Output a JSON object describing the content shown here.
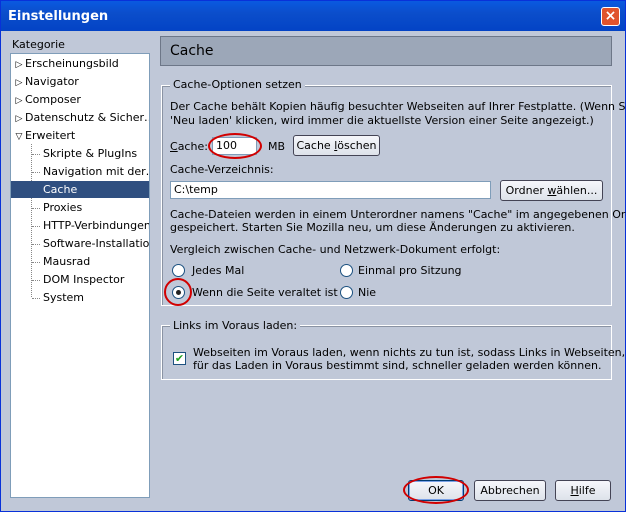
{
  "window": {
    "title": "Einstellungen",
    "close_glyph": "×"
  },
  "sidebar": {
    "heading": "Kategorie",
    "items": [
      {
        "label": "Erscheinungsbild",
        "expander": "▷"
      },
      {
        "label": "Navigator",
        "expander": "▷"
      },
      {
        "label": "Composer",
        "expander": "▷"
      },
      {
        "label": "Datenschutz & Sicher…",
        "expander": "▷"
      },
      {
        "label": "Erweitert",
        "expander": "▽"
      }
    ],
    "subitems": [
      {
        "label": "Skripte & PlugIns"
      },
      {
        "label": "Navigation mit der…"
      },
      {
        "label": "Cache",
        "selected": true
      },
      {
        "label": "Proxies"
      },
      {
        "label": "HTTP-Verbindungen"
      },
      {
        "label": "Software-Installation"
      },
      {
        "label": "Mausrad"
      },
      {
        "label": "DOM Inspector"
      },
      {
        "label": "System"
      }
    ]
  },
  "page": {
    "title": "Cache"
  },
  "cache_options": {
    "legend": "Cache-Optionen setzen",
    "description_line1": "Der Cache behält Kopien häufig besuchter Webseiten auf Ihrer Festplatte. (Wenn Sie",
    "description_line2": "'Neu laden' klicken, wird immer die aktuellste Version einer Seite angezeigt.)",
    "cache_label_accel": "C",
    "cache_label_rest": "ache:",
    "cache_size": "100",
    "unit": "MB",
    "clear_button_prefix": "Cache ",
    "clear_button_accel": "l",
    "clear_button_rest": "öschen",
    "directory_label": "Cache-Verzeichnis:",
    "directory_value": "C:\\temp",
    "choose_folder_prefix": "Ordner ",
    "choose_folder_accel": "w",
    "choose_folder_rest": "ählen...",
    "subfolder_line1": "Cache-Dateien werden in einem Unterordner namens \"Cache\" im angegebenen Ordner",
    "subfolder_line2": "gespeichert. Starten Sie Mozilla neu, um diese Änderungen zu aktivieren.",
    "compare_label": "Vergleich zwischen Cache- und Netzwerk-Dokument erfolgt:",
    "radios": [
      {
        "label": "Jedes Mal",
        "checked": false
      },
      {
        "label": "Einmal pro Sitzung",
        "checked": false
      },
      {
        "label": "Wenn die Seite veraltet ist",
        "checked": true
      },
      {
        "label": "Nie",
        "checked": false
      }
    ]
  },
  "prefetch": {
    "legend": "Links im Voraus laden:",
    "checkbox_checked": true,
    "checkbox_line1": "Webseiten im Voraus laden, wenn nichts zu tun ist, sodass Links in Webseiten, die",
    "checkbox_line2": "für das Laden in Voraus bestimmt sind, schneller geladen werden können."
  },
  "footer": {
    "ok": "OK",
    "cancel": "Abbrechen",
    "help_accel": "H",
    "help_rest": "ilfe"
  },
  "colors": {
    "titlebar": "#0b4ecb",
    "dialog_bg": "#c0c8d8",
    "selected_item": "#2f4f80",
    "highlight_ring": "#d10000"
  }
}
